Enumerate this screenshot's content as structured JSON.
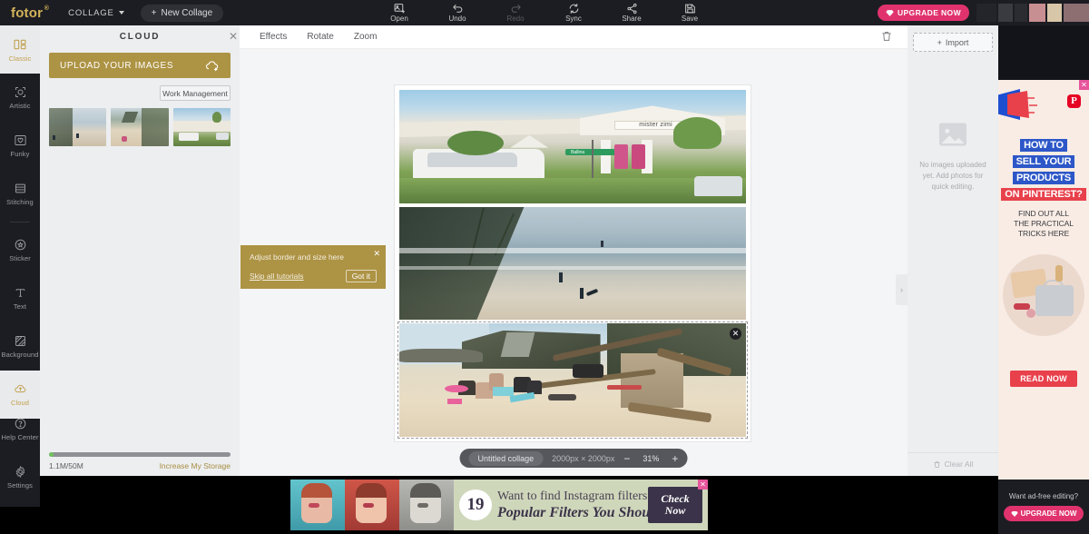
{
  "app": {
    "brand": "fotor",
    "brand_sup": "®",
    "mode_menu": "COLLAGE",
    "new_collage": "New Collage",
    "upgrade_now": "UPGRADE NOW"
  },
  "toolbar": {
    "items": [
      {
        "label": "Open",
        "icon": "open-image-icon",
        "disabled": false
      },
      {
        "label": "Undo",
        "icon": "undo-icon",
        "disabled": false
      },
      {
        "label": "Redo",
        "icon": "redo-icon",
        "disabled": true
      },
      {
        "label": "Sync",
        "icon": "sync-icon",
        "disabled": false
      },
      {
        "label": "Share",
        "icon": "share-icon",
        "disabled": false
      },
      {
        "label": "Save",
        "icon": "save-disk-icon",
        "disabled": false
      }
    ]
  },
  "sidebar": {
    "items": [
      {
        "label": "Classic",
        "icon": "classic-grid-icon",
        "active": true
      },
      {
        "label": "Artistic",
        "icon": "artistic-icon",
        "active": false
      },
      {
        "label": "Funky",
        "icon": "funky-heart-icon",
        "active": false
      },
      {
        "label": "Stitching",
        "icon": "stitching-rows-icon",
        "active": false
      },
      {
        "label": "Sticker",
        "icon": "sticker-star-icon",
        "active": false
      },
      {
        "label": "Text",
        "icon": "text-t-icon",
        "active": false
      },
      {
        "label": "Background",
        "icon": "background-pattern-icon",
        "active": false
      },
      {
        "label": "Cloud",
        "icon": "cloud-upload-icon",
        "active": true
      }
    ],
    "bottom_items": [
      {
        "label": "Help Center",
        "icon": "help-question-icon"
      },
      {
        "label": "Settings",
        "icon": "gear-icon"
      }
    ]
  },
  "cloud_panel": {
    "title": "CLOUD",
    "close_icon": "close-icon",
    "upload_button": "UPLOAD YOUR IMAGES",
    "upload_icon": "cloud-plus-icon",
    "work_management": "Work Management",
    "thumbnails": [
      {
        "name": "beach-surfers-thumbnail"
      },
      {
        "name": "beach-driftwood-thumbnail"
      },
      {
        "name": "mister-zimi-storefront-thumbnail"
      }
    ],
    "storage_used": "1.1M/50M",
    "storage_link": "Increase My Storage",
    "storage_percent": 2
  },
  "editor": {
    "tabs": [
      {
        "label": "Effects"
      },
      {
        "label": "Rotate"
      },
      {
        "label": "Zoom"
      }
    ],
    "trash_icon": "trash-icon",
    "collapse_icon": "chevron-right-icon",
    "cells": [
      {
        "name": "collage-cell-storefront",
        "selected": false
      },
      {
        "name": "collage-cell-surfers",
        "selected": false
      },
      {
        "name": "collage-cell-beach-picnic",
        "selected": true,
        "remove_icon": "close-icon"
      }
    ]
  },
  "status_bar": {
    "collage_name": "Untitled collage",
    "dimensions": "2000px × 2000px",
    "zoom_out": "−",
    "zoom_level": "31%",
    "zoom_in": "+"
  },
  "tutorial_tip": {
    "message": "Adjust border and size here",
    "skip": "Skip all tutorials",
    "confirm": "Got it",
    "close_icon": "close-icon"
  },
  "right_panel": {
    "import_label": "Import",
    "import_icon": "plus-icon",
    "empty_icon": "image-placeholder-icon",
    "empty_message": "No images uploaded yet. Add photos for quick editing.",
    "clear_all": "Clear All",
    "clear_icon": "trash-icon"
  },
  "right_ad": {
    "close_icon": "close-icon",
    "network_icon": "pinterest-icon",
    "network_glyph": "P",
    "headline_1": "HOW TO",
    "headline_2": "SELL YOUR",
    "headline_3": "PRODUCTS",
    "headline_4": "ON PINTEREST?",
    "subline_1": "FIND OUT ALL",
    "subline_2": "THE PRACTICAL",
    "subline_3": "TRICKS HERE",
    "cta": "READ NOW",
    "accent_blue": "#2d57c8",
    "accent_red": "#e8414b",
    "background": "#f8ece5"
  },
  "ad_free_promo": {
    "question": "Want ad-free editing?",
    "cta": "UPGRADE NOW",
    "diamond_icon": "diamond-icon",
    "accent": "#e0336e"
  },
  "bottom_ad": {
    "close_icon": "close-icon",
    "number": "19",
    "line_1": "Want to find Instagram filters online?",
    "line_2": "Popular Filters You Should Try",
    "cta_line_1": "Check",
    "cta_line_2": "Now",
    "background": "#cfd7bb"
  }
}
